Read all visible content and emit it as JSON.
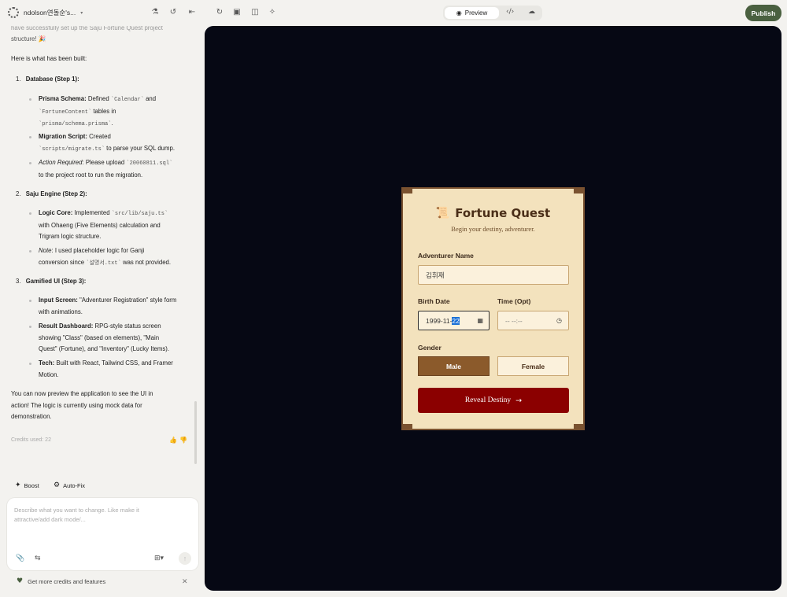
{
  "header": {
    "project_name": "ndolson연돌순's...",
    "preview_label": "Preview",
    "publish_label": "Publish"
  },
  "chat": {
    "top_fragment": "have successfully set up the Saju Fortune Quest project",
    "top_fragment2": "structure! 🎉",
    "intro": "Here is what has been built:",
    "step1_num": "1.",
    "step1_title": "Database (Step 1):",
    "s1b1_bold": "Prisma Schema:",
    "s1b1_text1": " Defined ",
    "s1b1_code1": "`Calendar`",
    "s1b1_text2": " and",
    "s1b1_code2": "`FortuneContent`",
    "s1b1_text3": " tables in",
    "s1b1_code3": "`prisma/schema.prisma`",
    "s1b1_text4": ".",
    "s1b2_bold": "Migration Script:",
    "s1b2_text1": " Created",
    "s1b2_code1": "`scripts/migrate.ts`",
    "s1b2_text2": " to parse your SQL dump.",
    "s1b3_ital": "Action Required",
    "s1b3_text1": ": Please upload ",
    "s1b3_code1": "`20060811.sql`",
    "s1b3_text2": "to the project root to run the migration.",
    "step2_num": "2.",
    "step2_title": "Saju Engine (Step 2):",
    "s2b1_bold": "Logic Core:",
    "s2b1_text1": " Implemented ",
    "s2b1_code1": "`src/lib/saju.ts`",
    "s2b1_text2": "with Ohaeng (Five Elements) calculation and",
    "s2b1_text3": "Trigram logic structure.",
    "s2b2_ital": "Note",
    "s2b2_text1": ": I used placeholder logic for Ganji",
    "s2b2_text2": "conversion since ",
    "s2b2_code1": "`설명서.txt`",
    "s2b2_text3": " was not provided.",
    "step3_num": "3.",
    "step3_title": "Gamified UI (Step 3):",
    "s3b1_bold": "Input Screen:",
    "s3b1_text1": " \"Adventurer Registration\" style form",
    "s3b1_text2": "with animations.",
    "s3b2_bold": "Result Dashboard:",
    "s3b2_text1": " RPG-style status screen",
    "s3b2_text2": "showing \"Class\" (based on elements), \"Main",
    "s3b2_text3": "Quest\" (Fortune), and \"Inventory\" (Lucky Items).",
    "s3b3_bold": "Tech:",
    "s3b3_text1": " Built with React, Tailwind CSS, and Framer",
    "s3b3_text2": "Motion.",
    "outro1": "You can now preview the application to see the UI in",
    "outro2": "action! The logic is currently using mock data for",
    "outro3": "demonstration.",
    "credits": "Credits used: 22"
  },
  "actions": {
    "boost": "Boost",
    "autofix": "Auto-Fix"
  },
  "composer": {
    "placeholder1": "Describe what you want to change. Like make it",
    "placeholder2": "attractive/add dark mode/..."
  },
  "promo": {
    "text": "Get more credits and features"
  },
  "app": {
    "title": "Fortune Quest",
    "subtitle": "Begin your destiny, adventurer.",
    "name_label": "Adventurer Name",
    "name_value": "김휘재",
    "birth_label": "Birth Date",
    "birth_value": "1999-11-",
    "birth_day": "22",
    "time_label": "Time (Opt)",
    "time_value": "-- --:--",
    "gender_label": "Gender",
    "male": "Male",
    "female": "Female",
    "reveal": "Reveal Destiny"
  }
}
